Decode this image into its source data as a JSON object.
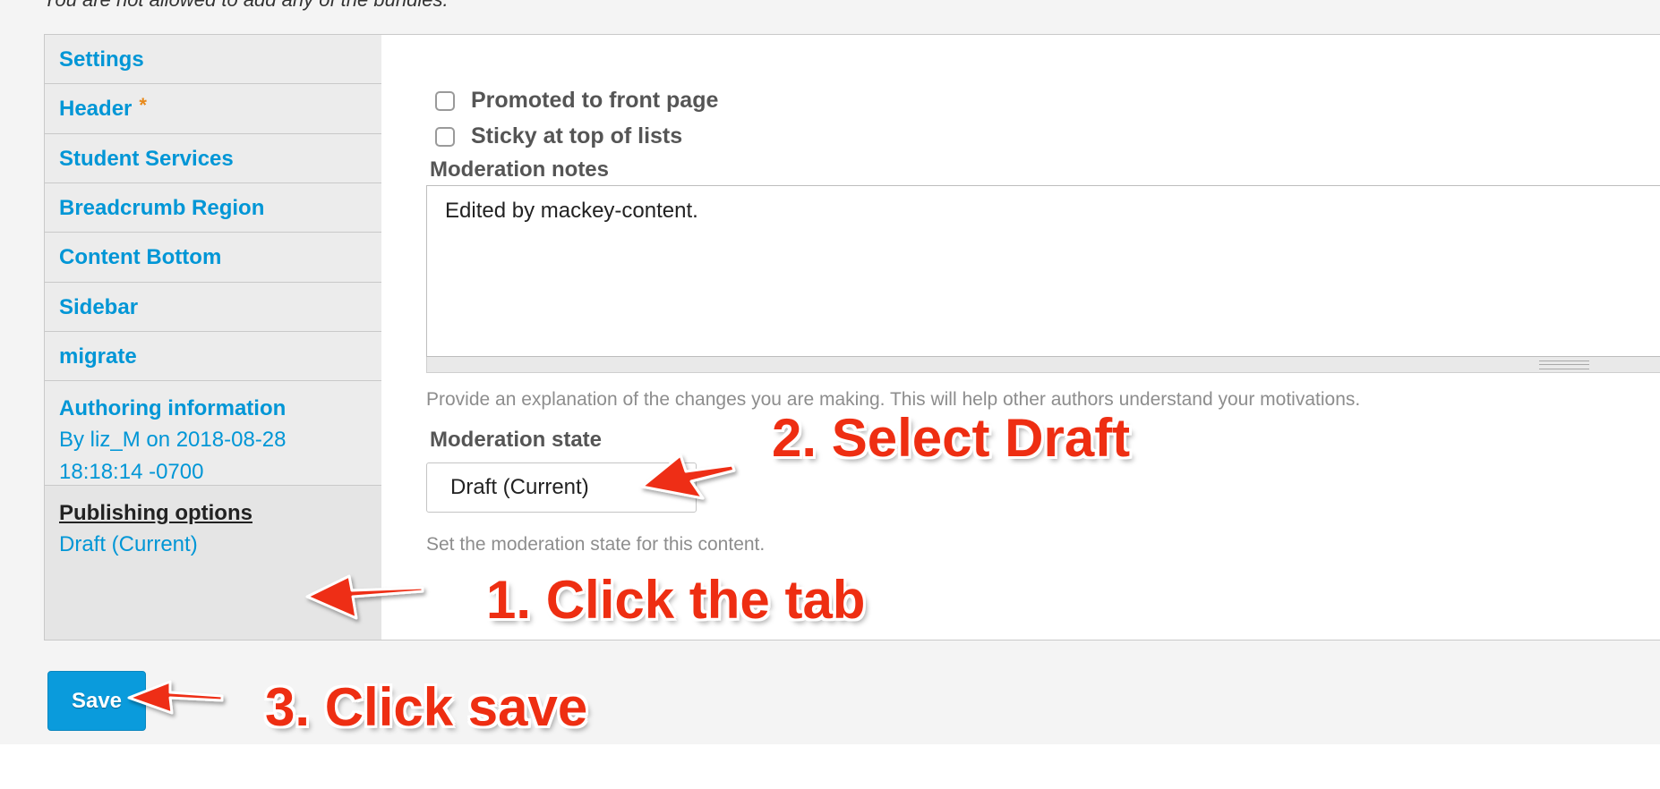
{
  "top_note": "You are not allowed to add any of the bundles.",
  "tabs": [
    {
      "label": "Settings"
    },
    {
      "label": "Header",
      "required_mark": "*"
    },
    {
      "label": "Student Services"
    },
    {
      "label": "Breadcrumb Region"
    },
    {
      "label": "Content Bottom"
    },
    {
      "label": "Sidebar"
    },
    {
      "label": "migrate"
    },
    {
      "label": "Authoring information",
      "summary_line1": "By liz_M on 2018-08-28",
      "summary_line2": "18:18:14 -0700"
    },
    {
      "label": "Publishing options",
      "summary": "Draft (Current)"
    }
  ],
  "publishing": {
    "promoted_label": "Promoted to front page",
    "sticky_label": "Sticky at top of lists",
    "notes_label": "Moderation notes",
    "notes_value": "Edited by mackey-content.",
    "notes_help": "Provide an explanation of the changes you are making. This will help other authors understand your motivations.",
    "state_label": "Moderation state",
    "state_value": "Draft (Current)",
    "state_help": "Set the moderation state for this content."
  },
  "actions": {
    "save_label": "Save"
  },
  "annotations": {
    "step1": "1. Click the tab",
    "step2": "2. Select Draft",
    "step3": "3. Click save"
  },
  "colors": {
    "link": "#0096d6",
    "button": "#0a9bdc",
    "annotation": "#ee2e12",
    "required": "#e8891a"
  }
}
